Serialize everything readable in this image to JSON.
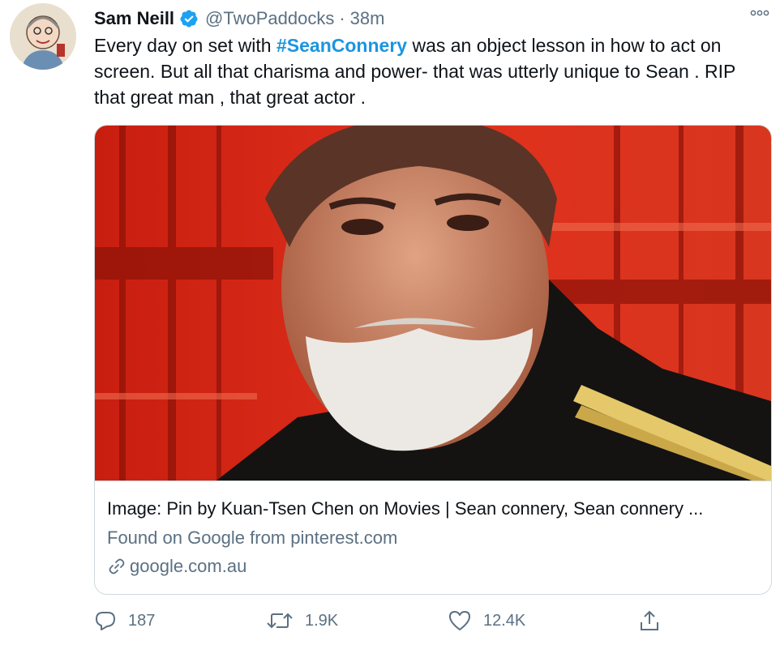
{
  "tweet": {
    "author_name": "Sam Neill",
    "handle": "@TwoPaddocks",
    "separator": "·",
    "time": "38m",
    "text_before": "Every day on set with ",
    "hashtag": "#SeanConnery",
    "text_after": " was an object lesson in how to act on screen.  But all that charisma and power- that was utterly unique to Sean . RIP that great man , that great actor ."
  },
  "card": {
    "title": "Image: Pin by Kuan-Tsen Chen on Movies | Sean connery, Sean connery ...",
    "description": "Found on Google from pinterest.com",
    "domain": "google.com.au"
  },
  "actions": {
    "reply_count": "187",
    "retweet_count": "1.9K",
    "like_count": "12.4K"
  },
  "icons": [
    "verified-badge-icon",
    "more-options-icon",
    "link-icon",
    "reply-icon",
    "retweet-icon",
    "like-icon",
    "share-icon"
  ],
  "colors": {
    "accent": "#1b95e0",
    "verified": "#1da1f2",
    "secondary_text": "#5b7083",
    "image_red": "#d42a1a"
  }
}
